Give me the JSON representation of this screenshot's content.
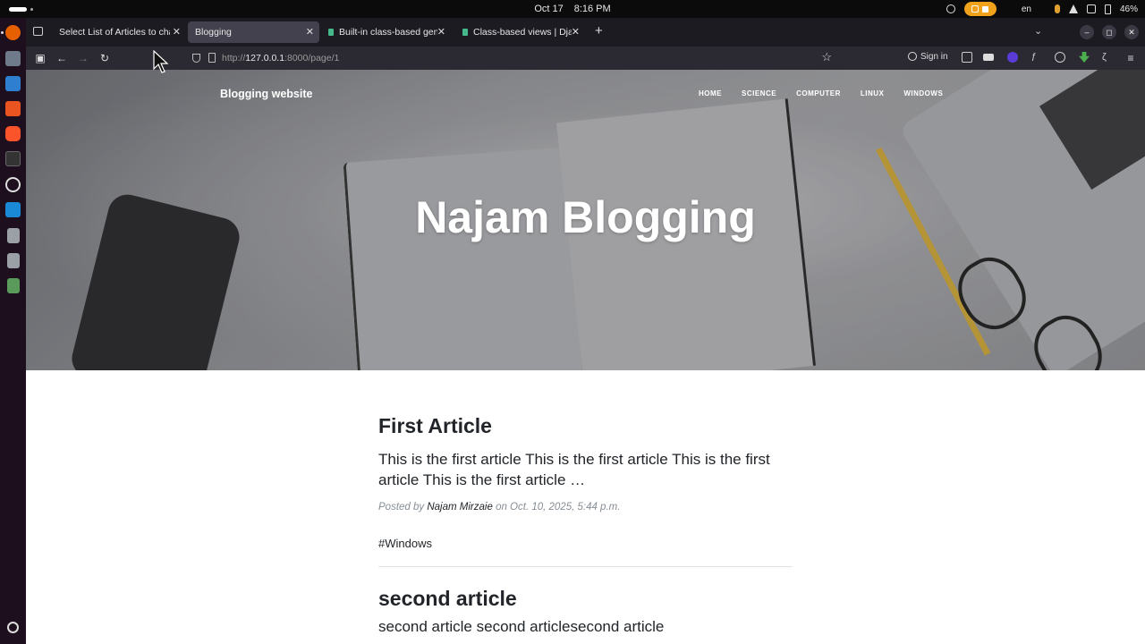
{
  "system": {
    "date": "Oct 17",
    "time": "8:16 PM",
    "language": "en",
    "battery": "46%"
  },
  "tabs": [
    {
      "title": "Select List of Articles to char",
      "active": false
    },
    {
      "title": "Blogging",
      "active": true
    },
    {
      "title": "Built-in class-based gene",
      "active": false
    },
    {
      "title": "Class-based views | Djang",
      "active": false
    }
  ],
  "address_bar": {
    "url_prefix": "http://",
    "host": "127.0.0.1",
    "url_rest": ":8000/page/1"
  },
  "toolbar": {
    "sign_in": "Sign in"
  },
  "site": {
    "brand": "Blogging website",
    "nav": [
      "HOME",
      "SCIENCE",
      "COMPUTER",
      "LINUX",
      "WINDOWS"
    ],
    "hero_title": "Najam Blogging"
  },
  "posts": [
    {
      "title": "First Article",
      "excerpt": "This is the first article This is the first article This is the first article This is the first article …",
      "meta_prefix": "Posted by",
      "author": "Najam Mirzaie",
      "meta_date": "on Oct. 10, 2025, 5:44 p.m.",
      "tag": "#Windows"
    },
    {
      "title": "second article",
      "excerpt": "second article second articlesecond article"
    }
  ],
  "icons": {
    "dock": [
      "firefox-icon",
      "files-icon",
      "software-icon",
      "appstore-icon",
      "brave-icon",
      "terminal-icon",
      "obs-icon",
      "vscode-icon",
      "document-icon",
      "document-icon",
      "trash-icon",
      "apps-grid-icon"
    ]
  }
}
